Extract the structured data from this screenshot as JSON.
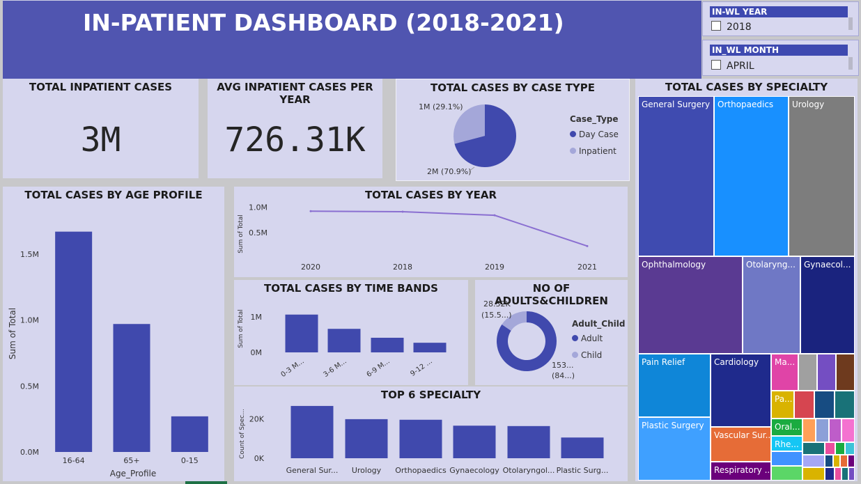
{
  "header": {
    "title": "IN-PATIENT DASHBOARD (2018-2021)"
  },
  "slicers": {
    "year": {
      "title": "IN-WL YEAR",
      "selected": "2018"
    },
    "month": {
      "title": "IN_WL MONTH",
      "selected": "APRIL"
    }
  },
  "kpis": {
    "total_cases": {
      "title": "TOTAL INPATIENT CASES",
      "value": "3M"
    },
    "avg_per_year": {
      "title": "AVG INPATIENT CASES PER YEAR",
      "value": "726.31K"
    }
  },
  "colors": {
    "primary": "#4049ad",
    "light": "#a4a7d9",
    "line": "#8a6fd1",
    "card": "#d6d6ee",
    "header": "#5055b0"
  },
  "chart_data": [
    {
      "id": "case_type",
      "type": "pie",
      "title": "TOTAL CASES BY CASE TYPE",
      "legend_title": "Case_Type",
      "legend_position": "right",
      "slices": [
        {
          "label": "Day Case",
          "value": 70.9,
          "data_label": "2M (70.9%)",
          "color": "#4049ad"
        },
        {
          "label": "Inpatient",
          "value": 29.1,
          "data_label": "1M (29.1%)",
          "color": "#a4a7d9"
        }
      ]
    },
    {
      "id": "age_profile",
      "type": "bar",
      "title": "TOTAL CASES BY AGE PROFILE",
      "xlabel": "Age_Profile",
      "ylabel": "Sum of Total",
      "categories": [
        "16-64",
        "65+",
        "0-15"
      ],
      "values": [
        1.67,
        0.97,
        0.27
      ],
      "ylim": [
        0,
        1.8
      ],
      "yticks": [
        {
          "v": 0,
          "label": "0.0M"
        },
        {
          "v": 0.5,
          "label": "0.5M"
        },
        {
          "v": 1.0,
          "label": "1.0M"
        },
        {
          "v": 1.5,
          "label": "1.5M"
        }
      ]
    },
    {
      "id": "by_year",
      "type": "line",
      "title": "TOTAL CASES BY YEAR",
      "ylabel": "Sum of Total",
      "categories": [
        "2020",
        "2018",
        "2019",
        "2021"
      ],
      "values": [
        0.92,
        0.91,
        0.84,
        0.24
      ],
      "ylim": [
        0,
        1.1
      ],
      "yticks": [
        {
          "v": 0.5,
          "label": "0.5M"
        },
        {
          "v": 1.0,
          "label": "1.0M"
        }
      ]
    },
    {
      "id": "time_bands",
      "type": "bar",
      "title": "TOTAL CASES BY TIME BANDS",
      "ylabel": "Sum of Total",
      "categories": [
        "0-3 M...",
        "3-6 M...",
        "6-9 M...",
        "9-12 ..."
      ],
      "values": [
        1.06,
        0.66,
        0.41,
        0.27
      ],
      "ylim": [
        0,
        1.25
      ],
      "yticks": [
        {
          "v": 0,
          "label": "0M"
        },
        {
          "v": 1.0,
          "label": "1M"
        }
      ]
    },
    {
      "id": "adults_children",
      "type": "pie",
      "title": "NO OF ADULTS&CHILDREN",
      "legend_title": "Adult_Child",
      "legend_position": "right",
      "slices": [
        {
          "label": "Adult",
          "value": 84.5,
          "data_label_1": "153...",
          "data_label_2": "(84...)",
          "color": "#4049ad"
        },
        {
          "label": "Child",
          "value": 15.5,
          "data_label_1": "28.32K",
          "data_label_2": "(15.5...)",
          "color": "#a4a7d9"
        }
      ]
    },
    {
      "id": "top6",
      "type": "bar",
      "title": "TOP 6 SPECIALTY",
      "ylabel": "Count of Spec...",
      "categories": [
        "General Sur...",
        "Urology",
        "Orthopaedics",
        "Gynaecology",
        "Otolaryngol...",
        "Plastic Surg..."
      ],
      "values": [
        26500,
        19800,
        19500,
        16500,
        16300,
        10500
      ],
      "ylim": [
        0,
        30000
      ],
      "yticks": [
        {
          "v": 0,
          "label": "0K"
        },
        {
          "v": 20000,
          "label": "20K"
        }
      ]
    },
    {
      "id": "specialty_treemap",
      "type": "treemap",
      "title": "TOTAL CASES BY SPECIALTY",
      "labelled_tiles": [
        "General Surgery",
        "Orthopaedics",
        "Urology",
        "Ophthalmology",
        "Otolaryng...",
        "Gynaecol...",
        "Pain Relief",
        "Cardiology",
        "Ma...",
        "Pa...",
        "Plastic Surgery",
        "Vascular Sur...",
        "Oral...",
        "Rhe...",
        "Respiratory ..."
      ]
    }
  ]
}
